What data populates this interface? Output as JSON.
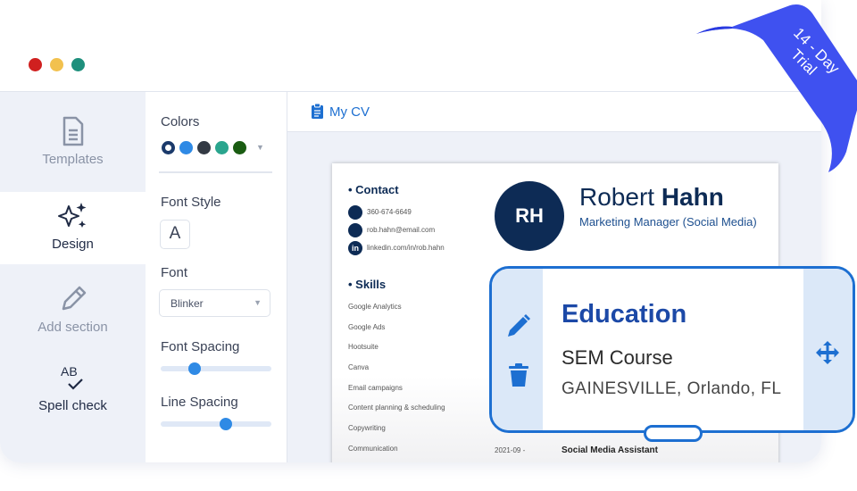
{
  "window": {
    "dots": [
      "#d0201f",
      "#f2c14e",
      "#1e8f7c"
    ]
  },
  "ribbon": {
    "line1": "14 - Day",
    "line2": "Trial",
    "color": "#3f51f0"
  },
  "sidebar": {
    "items": [
      {
        "label": "Templates",
        "icon": "document-icon",
        "active": false
      },
      {
        "label": "Design",
        "icon": "sparkles-icon",
        "active": true
      },
      {
        "label": "Add section",
        "icon": "pencil-icon",
        "active": false
      },
      {
        "label": "Spell check",
        "icon": "spell-check-icon",
        "active": false
      }
    ]
  },
  "design": {
    "colors_label": "Colors",
    "colors": [
      "#1b3a6b",
      "#2f8ae5",
      "#333a44",
      "#2aa58e",
      "#1a5c12"
    ],
    "font_style_label": "Font Style",
    "font_style_value": "A",
    "font_label": "Font",
    "font_value": "Blinker",
    "font_spacing_label": "Font Spacing",
    "font_spacing_value": 0.31,
    "line_spacing_label": "Line Spacing",
    "line_spacing_value": 0.59
  },
  "main": {
    "title": "My CV"
  },
  "cv": {
    "initials": "RH",
    "first_name": "Robert",
    "last_name": "Hahn",
    "job_title": "Marketing Manager (Social Media)",
    "contact_heading": "Contact",
    "phone": "360-674-6649",
    "email": "rob.hahn@email.com",
    "linkedin": "linkedin.com/in/rob.hahn",
    "skills_heading": "Skills",
    "skills": [
      "Google Analytics",
      "Google Ads",
      "Hootsuite",
      "Canva",
      "Email campaigns",
      "Content planning & scheduling",
      "Copywriting",
      "Communication"
    ],
    "exp_date": "2021-09 -",
    "exp_title": "Social Media Assistant"
  },
  "overlay": {
    "heading": "Education",
    "course": "SEM Course",
    "location": "GAINESVILLE, Orlando, FL"
  }
}
